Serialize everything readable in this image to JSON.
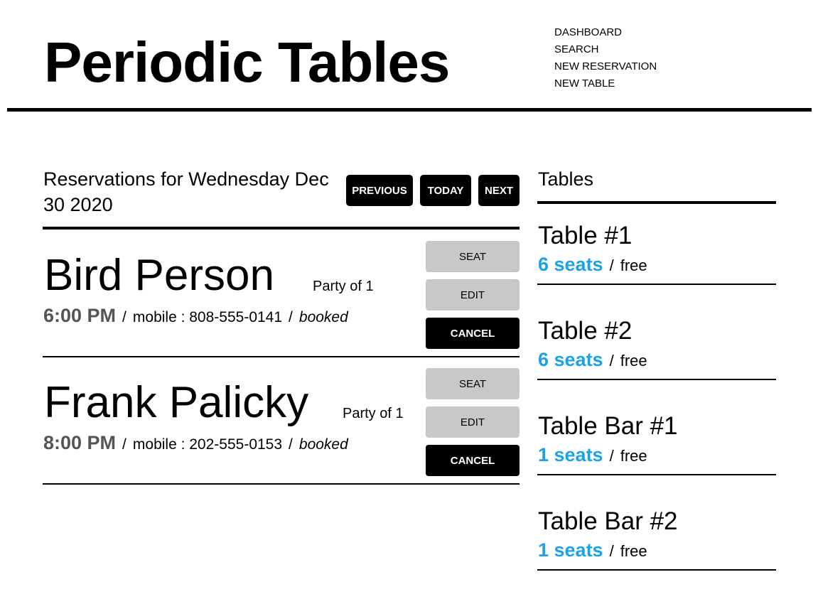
{
  "header": {
    "title": "Periodic Tables",
    "nav": [
      "DASHBOARD",
      "SEARCH",
      "NEW RESERVATION",
      "NEW TABLE"
    ]
  },
  "reservations_section": {
    "heading": "Reservations for Wednesday Dec 30 2020",
    "buttons": {
      "previous": "PREVIOUS",
      "today": "TODAY",
      "next": "NEXT"
    },
    "reservations": [
      {
        "name": "Bird Person",
        "party": "Party of 1",
        "time": "6:00 PM",
        "mobile": "mobile : 808-555-0141",
        "status": "booked",
        "seat": "SEAT",
        "edit": "EDIT",
        "cancel": "CANCEL"
      },
      {
        "name": "Frank Palicky",
        "party": "Party of 1",
        "time": "8:00 PM",
        "mobile": "mobile : 202-555-0153",
        "status": "booked",
        "seat": "SEAT",
        "edit": "EDIT",
        "cancel": "CANCEL"
      }
    ]
  },
  "tables_section": {
    "heading": "Tables",
    "tables": [
      {
        "name": "Table #1",
        "seats": "6 seats",
        "status": "free"
      },
      {
        "name": "Table #2",
        "seats": "6 seats",
        "status": "free"
      },
      {
        "name": "Table Bar #1",
        "seats": "1 seats",
        "status": "free"
      },
      {
        "name": "Table Bar #2",
        "seats": "1 seats",
        "status": "free"
      }
    ]
  },
  "colors": {
    "accent": "#1aa3e6",
    "muted_time": "#555555",
    "button_gray": "#c8c8c8"
  }
}
